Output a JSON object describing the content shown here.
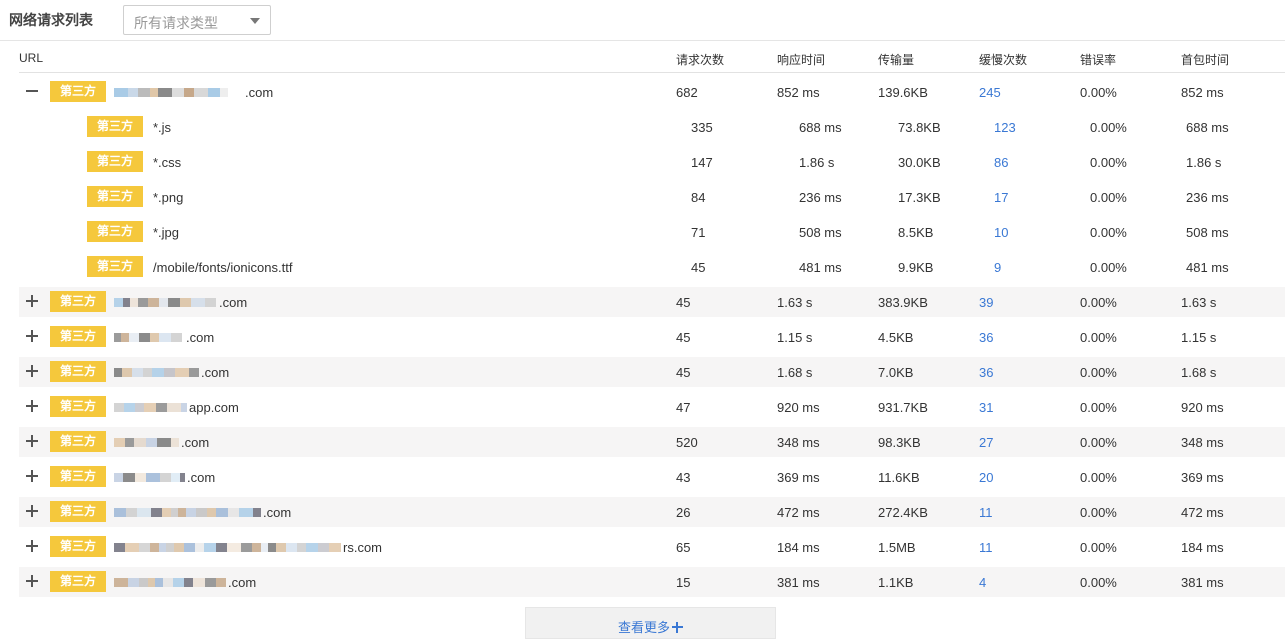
{
  "header": {
    "title": "网络请求列表",
    "filter_value": "所有请求类型"
  },
  "columns": [
    "URL",
    "请求次数",
    "响应时间",
    "传输量",
    "缓慢次数",
    "错误率",
    "首包时间"
  ],
  "tag_label": "第三方",
  "expanded_row": {
    "domain_suffix": ".com",
    "requests": "682",
    "response_time": "852 ms",
    "transfer": "139.6KB",
    "slow_count": "245",
    "error_rate": "0.00%",
    "first_byte": "852 ms"
  },
  "sub_rows": [
    {
      "url": "*.js",
      "requests": "335",
      "response_time": "688 ms",
      "transfer": "73.8KB",
      "slow_count": "123",
      "error_rate": "0.00%",
      "first_byte": "688 ms"
    },
    {
      "url": "*.css",
      "requests": "147",
      "response_time": "1.86 s",
      "transfer": "30.0KB",
      "slow_count": "86",
      "error_rate": "0.00%",
      "first_byte": "1.86 s"
    },
    {
      "url": "*.png",
      "requests": "84",
      "response_time": "236 ms",
      "transfer": "17.3KB",
      "slow_count": "17",
      "error_rate": "0.00%",
      "first_byte": "236 ms"
    },
    {
      "url": "*.jpg",
      "requests": "71",
      "response_time": "508 ms",
      "transfer": "8.5KB",
      "slow_count": "10",
      "error_rate": "0.00%",
      "first_byte": "508 ms"
    },
    {
      "url": "/mobile/fonts/ionicons.ttf",
      "requests": "45",
      "response_time": "481 ms",
      "transfer": "9.9KB",
      "slow_count": "9",
      "error_rate": "0.00%",
      "first_byte": "481 ms"
    }
  ],
  "rows": [
    {
      "domain_suffix": ".com",
      "requests": "45",
      "response_time": "1.63 s",
      "transfer": "383.9KB",
      "slow_count": "39",
      "error_rate": "0.00%",
      "first_byte": "1.63 s"
    },
    {
      "domain_suffix": ".com",
      "requests": "45",
      "response_time": "1.15 s",
      "transfer": "4.5KB",
      "slow_count": "36",
      "error_rate": "0.00%",
      "first_byte": "1.15 s"
    },
    {
      "domain_suffix": ".com",
      "requests": "45",
      "response_time": "1.68 s",
      "transfer": "7.0KB",
      "slow_count": "36",
      "error_rate": "0.00%",
      "first_byte": "1.68 s"
    },
    {
      "domain_suffix": "app.com",
      "requests": "47",
      "response_time": "920 ms",
      "transfer": "931.7KB",
      "slow_count": "31",
      "error_rate": "0.00%",
      "first_byte": "920 ms"
    },
    {
      "domain_suffix": ".com",
      "requests": "520",
      "response_time": "348 ms",
      "transfer": "98.3KB",
      "slow_count": "27",
      "error_rate": "0.00%",
      "first_byte": "348 ms"
    },
    {
      "domain_suffix": ".com",
      "requests": "43",
      "response_time": "369 ms",
      "transfer": "11.6KB",
      "slow_count": "20",
      "error_rate": "0.00%",
      "first_byte": "369 ms"
    },
    {
      "domain_suffix": ".com",
      "requests": "26",
      "response_time": "472 ms",
      "transfer": "272.4KB",
      "slow_count": "11",
      "error_rate": "0.00%",
      "first_byte": "472 ms"
    },
    {
      "domain_suffix": "rs.com",
      "requests": "65",
      "response_time": "184 ms",
      "transfer": "1.5MB",
      "slow_count": "11",
      "error_rate": "0.00%",
      "first_byte": "184 ms"
    },
    {
      "domain_suffix": ".com",
      "requests": "15",
      "response_time": "381 ms",
      "transfer": "1.1KB",
      "slow_count": "4",
      "error_rate": "0.00%",
      "first_byte": "381 ms"
    }
  ],
  "load_more_label": "查看更多",
  "colors": {
    "tag": "#f5c83c",
    "link": "#3a78d4",
    "row_shade": "#f6f5f5"
  }
}
